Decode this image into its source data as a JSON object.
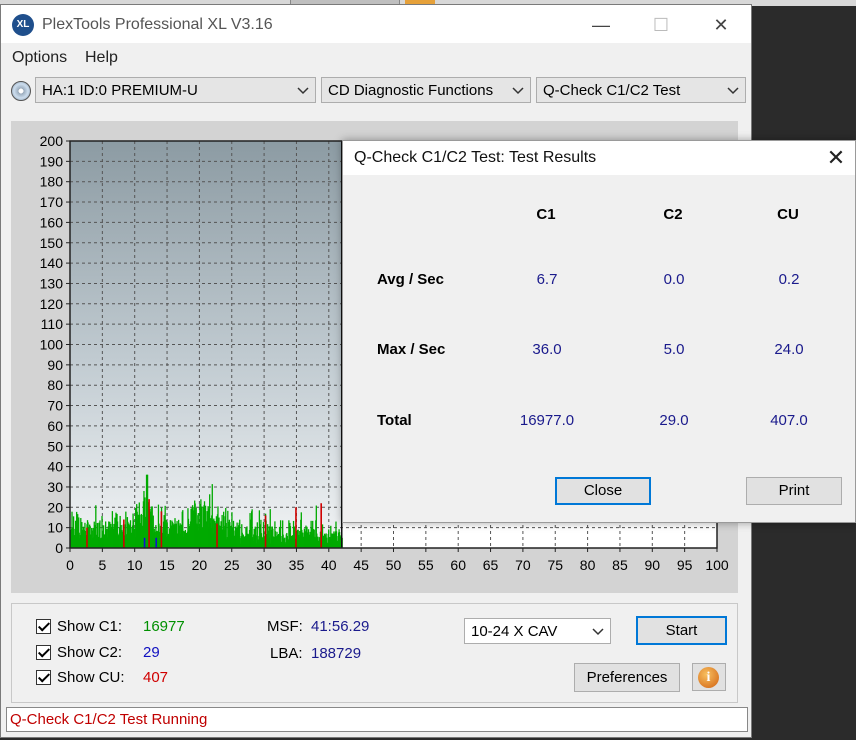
{
  "window": {
    "title": "PlexTools Professional XL V3.16",
    "logo_text": "XL"
  },
  "menu": [
    "Options",
    "Help"
  ],
  "toolbar": {
    "drive": "HA:1 ID:0  PREMIUM-U",
    "function": "CD Diagnostic Functions",
    "test": "Q-Check C1/C2 Test"
  },
  "chart_data": {
    "type": "bar",
    "y_ticks": [
      200,
      190,
      180,
      170,
      160,
      150,
      140,
      130,
      120,
      110,
      100,
      90,
      80,
      70,
      60,
      50,
      40,
      30,
      20,
      10,
      0
    ],
    "x_ticks": [
      0,
      5,
      10,
      15,
      20,
      25,
      30,
      35,
      40,
      45,
      50,
      55,
      60,
      65,
      70,
      75,
      80,
      85,
      90,
      95,
      100
    ],
    "xlim": [
      0,
      100
    ],
    "ylim": [
      0,
      200
    ],
    "grid": true,
    "progress_x": 42,
    "c1_peak": 36,
    "series_colors": {
      "c1": "#00aa00",
      "c2": "#1010d0",
      "cu": "#d00000"
    }
  },
  "bottom": {
    "show_c1_label": "Show C1:",
    "show_c1_value": "16977",
    "show_c2_label": "Show C2:",
    "show_c2_value": "29",
    "show_cu_label": "Show CU:",
    "show_cu_value": "407",
    "msf_label": "MSF:",
    "msf_value": "41:56.29",
    "lba_label": "LBA:",
    "lba_value": "188729",
    "speed": "10-24 X CAV",
    "start": "Start",
    "preferences": "Preferences",
    "info_icon": "i"
  },
  "status": "Q-Check C1/C2 Test Running",
  "dialog": {
    "title": "Q-Check C1/C2 Test: Test Results",
    "columns": [
      "C1",
      "C2",
      "CU"
    ],
    "rows": [
      {
        "label": "Avg / Sec",
        "values": [
          "6.7",
          "0.0",
          "0.2"
        ]
      },
      {
        "label": "Max / Sec",
        "values": [
          "36.0",
          "5.0",
          "24.0"
        ]
      },
      {
        "label": "Total",
        "values": [
          "16977.0",
          "29.0",
          "407.0"
        ]
      }
    ],
    "close": "Close",
    "print": "Print"
  }
}
